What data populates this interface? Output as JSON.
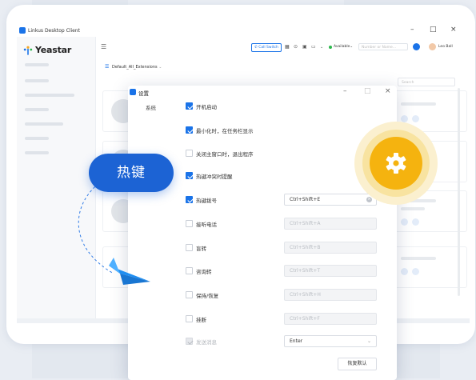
{
  "window": {
    "title": "Linkus Desktop Client",
    "controls": [
      "–",
      "□",
      "×"
    ]
  },
  "brand": {
    "name": "Yeastar"
  },
  "topnav": {
    "menu_icon": "hamburger-icon",
    "call_switch_label": "Call Switch",
    "status_label": "Available",
    "number_placeholder": "Number or Name...",
    "user_name": "Leo Ball"
  },
  "extension_group": {
    "label": "Default_All_Extensions"
  },
  "search": {
    "placeholder": "Search"
  },
  "dialog": {
    "title": "设置",
    "controls": [
      "–",
      "□",
      "×"
    ],
    "section": "系统",
    "options": [
      {
        "label": "开机启动",
        "checked": true
      },
      {
        "label": "最小化时，在任务栏显示",
        "checked": true
      },
      {
        "label": "关闭主窗口时，退出程序",
        "checked": false
      },
      {
        "label": "热键冲突时提醒",
        "checked": true
      }
    ],
    "hotkeys": [
      {
        "label": "热键拨号",
        "checked": true,
        "value": "Ctrl+Shift+E"
      },
      {
        "label": "接听电话",
        "checked": false,
        "value": "Ctrl+Shift+A"
      },
      {
        "label": "盲转",
        "checked": false,
        "value": "Ctrl+Shift+B"
      },
      {
        "label": "咨询转",
        "checked": false,
        "value": "Ctrl+Shift+T"
      },
      {
        "label": "保持/恢复",
        "checked": false,
        "value": "Ctrl+Shift+H"
      },
      {
        "label": "挂断",
        "checked": false,
        "value": "Ctrl+Shift+F"
      },
      {
        "label": "发送消息",
        "checked": true,
        "disabled": true,
        "value": "Enter"
      }
    ],
    "reset_label": "恢复默认"
  },
  "callout": {
    "label": "热键"
  },
  "colors": {
    "accent": "#1a73e8",
    "callout_blue": "#1c63d4",
    "gear_yellow": "#f5b30f",
    "status_green": "#2db84d"
  }
}
